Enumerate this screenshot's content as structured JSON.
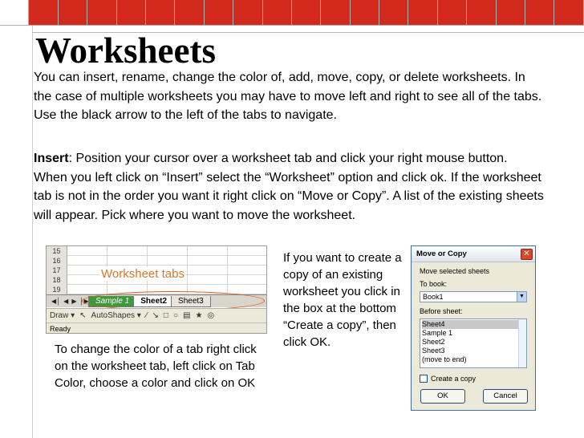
{
  "slide": {
    "title": "Worksheets",
    "para1": "You can insert, rename, change the color of, add, move, copy, or delete worksheets. In the case of multiple worksheets you may have to move left and right to see all of the tabs.  Use the black arrow to the left of the tabs to navigate.",
    "insert_label": "Insert",
    "para2": ":  Position your cursor over a worksheet tab and click your right mouse button.  When you left click on “Insert” select the “Worksheet” option and click ok.  If the worksheet tab is not in the order you want it right click on “Move or Copy”.  A list of the existing sheets will appear.  Pick where you want to move the worksheet.",
    "caption_left": "To change the color of a tab right click on the worksheet tab, left click on Tab Color, choose a color and click on OK",
    "caption_right": "If you want to create a copy of an existing worksheet you click in the box at the bottom “Create a copy”, then click OK."
  },
  "excel": {
    "row_numbers": [
      "15",
      "16",
      "17",
      "18",
      "19"
    ],
    "overlay_label": "Worksheet tabs",
    "tabs": [
      "Sample 1",
      "Sheet2",
      "Sheet3"
    ],
    "draw_label": "Draw ▾",
    "autoshapes_label": "AutoShapes ▾",
    "status": "Ready"
  },
  "dialog": {
    "title": "Move or Copy",
    "move_selected": "Move selected sheets",
    "to_book_label": "To book:",
    "to_book_value": "Book1",
    "before_sheet_label": "Before sheet:",
    "sheets": [
      "Sheet4",
      "Sample 1",
      "Sheet2",
      "Sheet3",
      "(move to end)"
    ],
    "create_copy": "Create a copy",
    "ok": "OK",
    "cancel": "Cancel"
  },
  "colors": {
    "accent_red": "#d12a1c",
    "label_orange": "#d8772a",
    "tab_green": "#3d9a3b"
  }
}
